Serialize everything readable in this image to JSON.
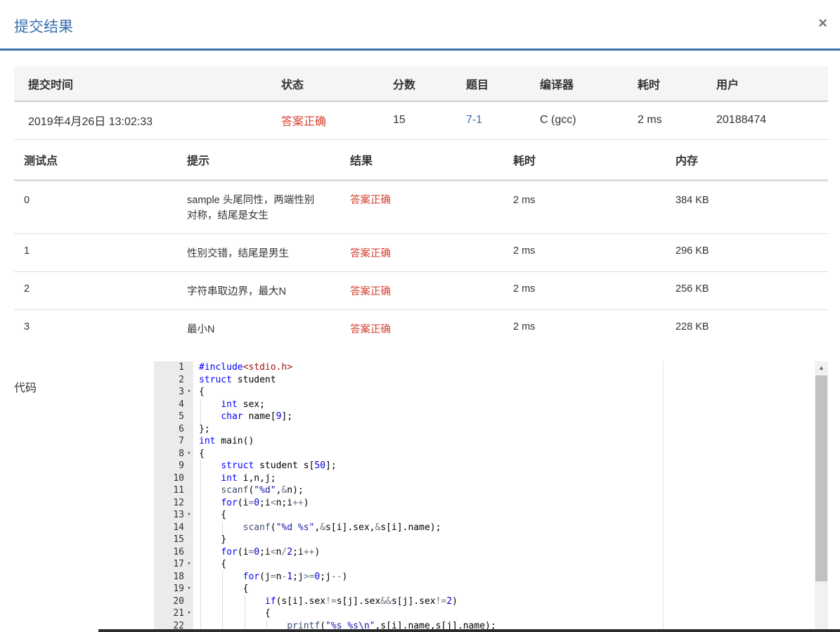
{
  "modal": {
    "title": "提交结果",
    "close_icon": "×"
  },
  "summary": {
    "headers": [
      "提交时间",
      "状态",
      "分数",
      "题目",
      "编译器",
      "耗时",
      "用户"
    ],
    "row": {
      "time": "2019年4月26日 13:02:33",
      "status": "答案正确",
      "score": "15",
      "problem": "7-1",
      "compiler": "C (gcc)",
      "elapsed": "2 ms",
      "user": "20188474"
    }
  },
  "tests": {
    "headers": [
      "测试点",
      "提示",
      "结果",
      "耗时",
      "内存"
    ],
    "rows": [
      {
        "id": "0",
        "hint": "sample 头尾同性，两端性别对称，结尾是女生",
        "result": "答案正确",
        "time": "2 ms",
        "memory": "384 KB"
      },
      {
        "id": "1",
        "hint": "性别交错，结尾是男生",
        "result": "答案正确",
        "time": "2 ms",
        "memory": "296 KB"
      },
      {
        "id": "2",
        "hint": "字符串取边界，最大N",
        "result": "答案正确",
        "time": "2 ms",
        "memory": "256 KB"
      },
      {
        "id": "3",
        "hint": "最小N",
        "result": "答案正确",
        "time": "2 ms",
        "memory": "228 KB"
      }
    ]
  },
  "code": {
    "label": "代码",
    "lines": [
      "#include<stdio.h>",
      "struct student",
      "{",
      "    int sex;",
      "    char name[9];",
      "};",
      "int main()",
      "{",
      "    struct student s[50];",
      "    int i,n,j;",
      "    scanf(\"%d\",&n);",
      "    for(i=0;i<n;i++)",
      "    {",
      "        scanf(\"%d %s\",&s[i].sex,&s[i].name);",
      "    }",
      "    for(i=0;i<n/2;i++)",
      "    {",
      "        for(j=n-1;j>=0;j--)",
      "        {",
      "            if(s[i].sex!=s[j].sex&&s[j].sex!=2)",
      "            {",
      "                printf(\"%s %s\\n\",s[i].name,s[j].name);"
    ],
    "fold_lines": [
      3,
      8,
      13,
      17,
      19,
      21
    ],
    "fold_icon": "▾"
  },
  "scrollbar": {
    "up_icon": "▲",
    "position": 0
  },
  "colors": {
    "accent": "#3a6fb0",
    "status_ok": "#d9412f",
    "keyword": "#0000ff",
    "string": "#1a1aa6",
    "include": "#a31515"
  }
}
